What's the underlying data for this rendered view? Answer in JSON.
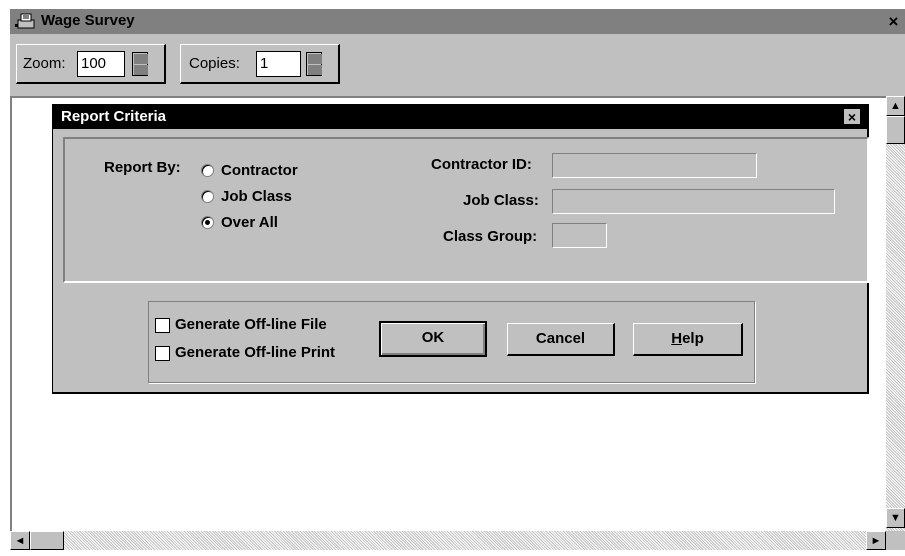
{
  "window": {
    "title": "Wage Survey",
    "close_glyph": "×"
  },
  "toolbar": {
    "zoom_label": "Zoom:",
    "zoom_value": "100",
    "copies_label": "Copies:",
    "copies_value": "1"
  },
  "dialog": {
    "title": "Report Criteria",
    "close_glyph": "×",
    "report_by_label": "Report By:",
    "radios": [
      {
        "label": "Contractor",
        "selected": false
      },
      {
        "label": "Job Class",
        "selected": false
      },
      {
        "label": "Over All",
        "selected": true
      }
    ],
    "fields": {
      "contractor_id_label": "Contractor ID:",
      "contractor_id_value": "",
      "job_class_label": "Job Class:",
      "job_class_value": "",
      "class_group_label": "Class Group:",
      "class_group_value": ""
    },
    "checkboxes": [
      {
        "label": "Generate Off-line File",
        "checked": false
      },
      {
        "label": "Generate Off-line Print",
        "checked": false
      }
    ],
    "buttons": {
      "ok": "OK",
      "cancel": "Cancel",
      "help_first": "H",
      "help_rest": "elp"
    }
  },
  "scrollbars": {
    "up": "▲",
    "down": "▼",
    "left": "◄",
    "right": "►"
  }
}
